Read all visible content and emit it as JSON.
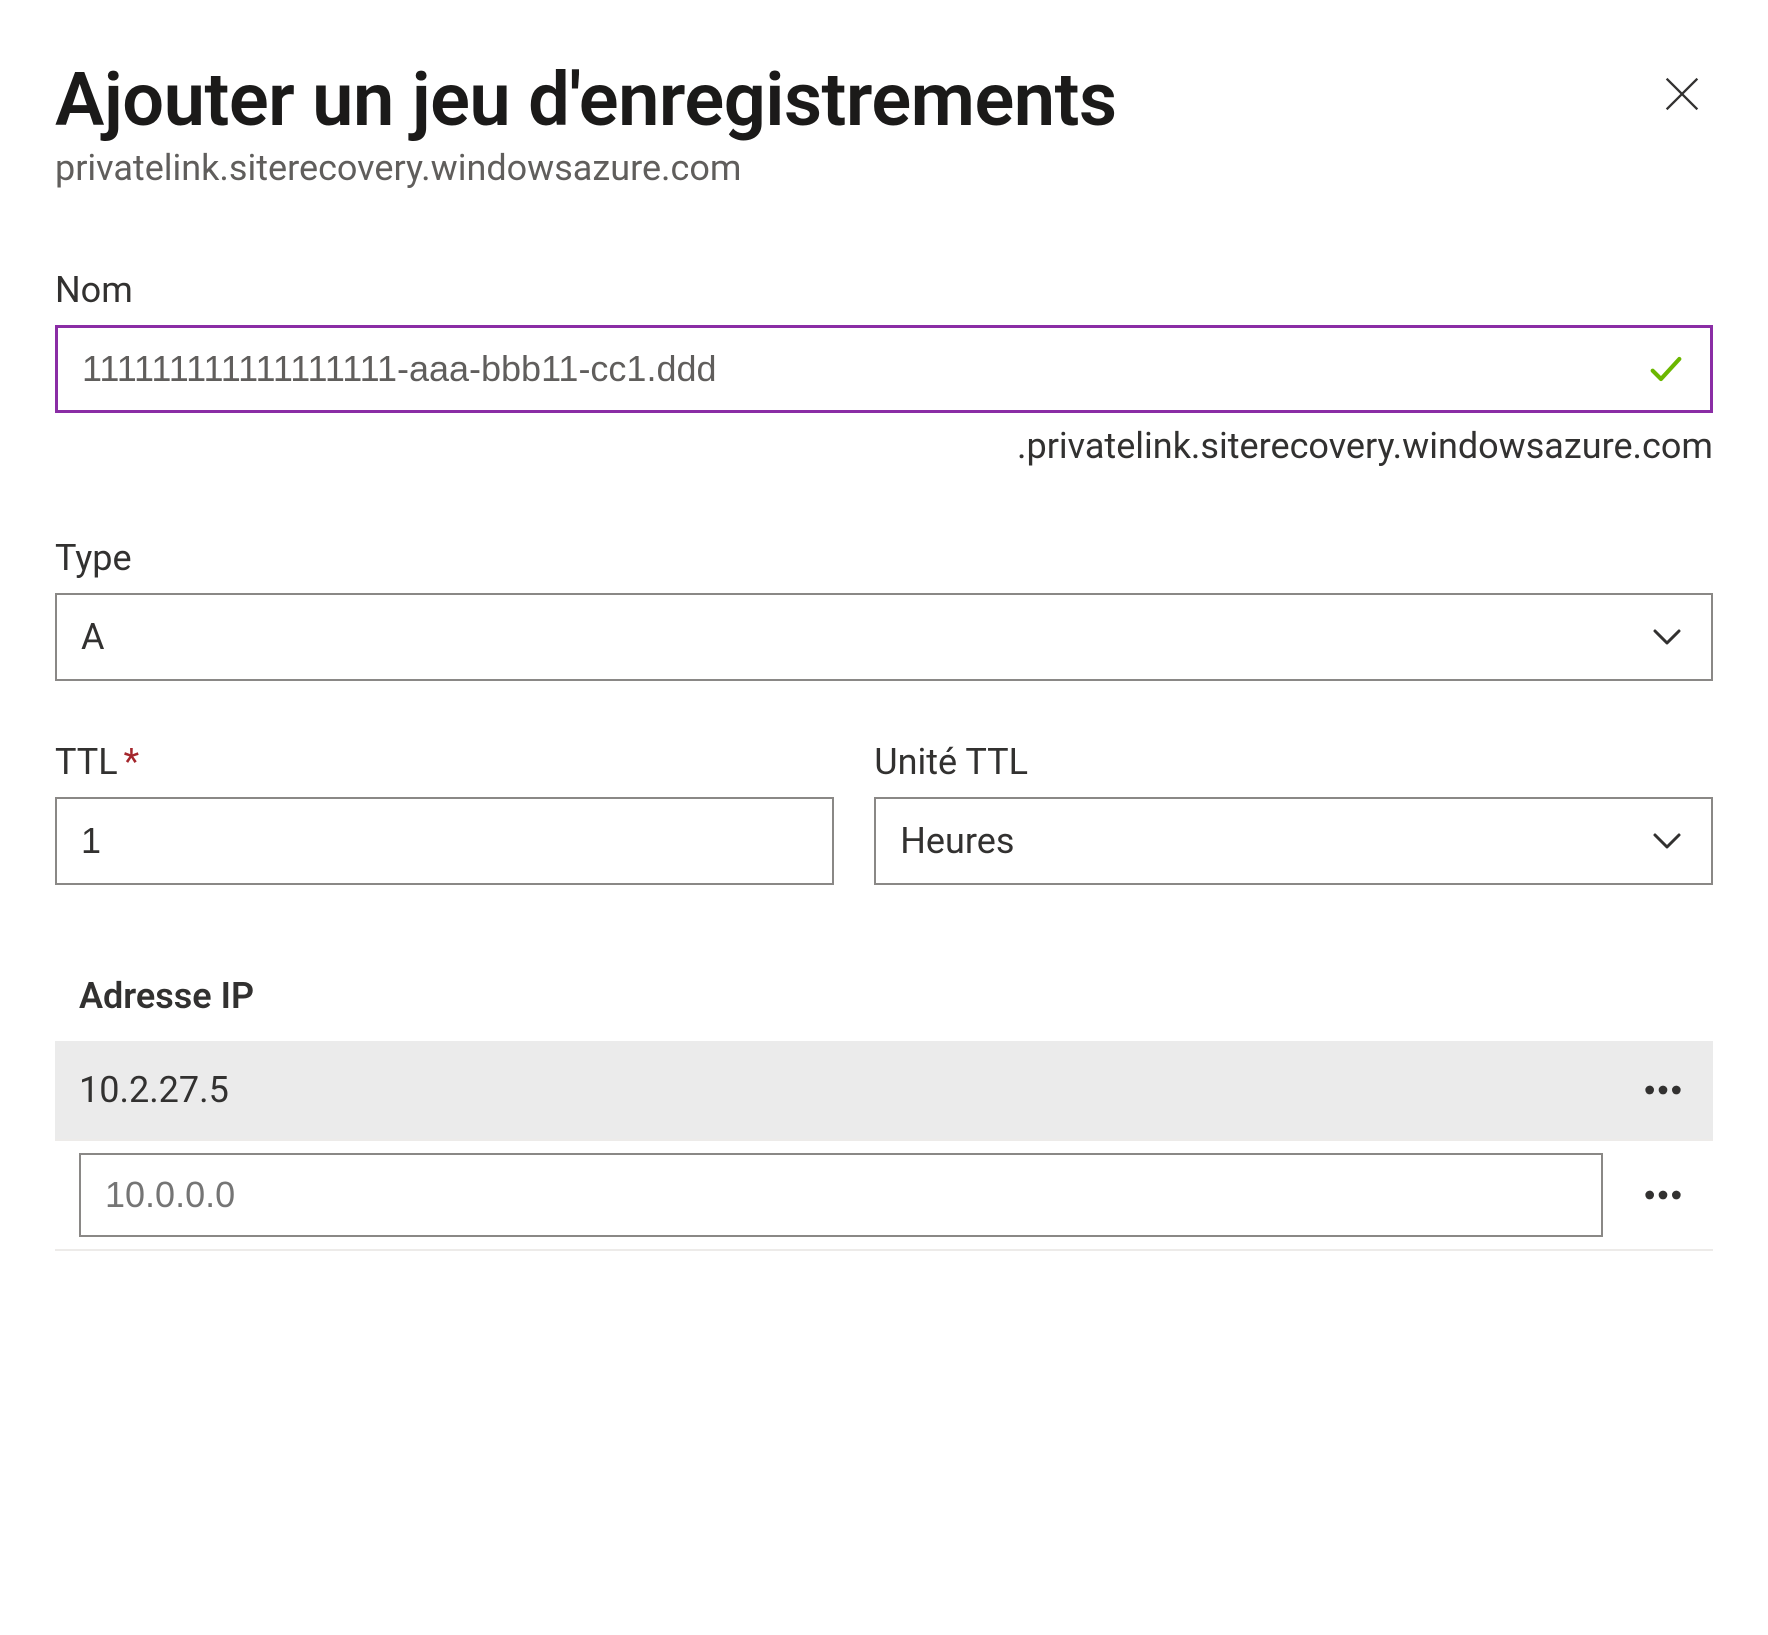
{
  "header": {
    "title": "Ajouter un jeu d'enregistrements",
    "subtitle": "privatelink.siterecovery.windowsazure.com"
  },
  "name_field": {
    "label": "Nom",
    "value": "111111111111111111-aaa-bbb11-cc1.ddd",
    "suffix": ".privatelink.siterecovery.windowsazure.com"
  },
  "type_field": {
    "label": "Type",
    "value": "A"
  },
  "ttl_field": {
    "label": "TTL",
    "value": "1"
  },
  "ttl_unit_field": {
    "label": "Unité TTL",
    "value": "Heures"
  },
  "ip_section": {
    "header": "Adresse IP",
    "rows": [
      {
        "value": "10.2.27.5"
      }
    ],
    "new_placeholder": "10.0.0.0"
  }
}
